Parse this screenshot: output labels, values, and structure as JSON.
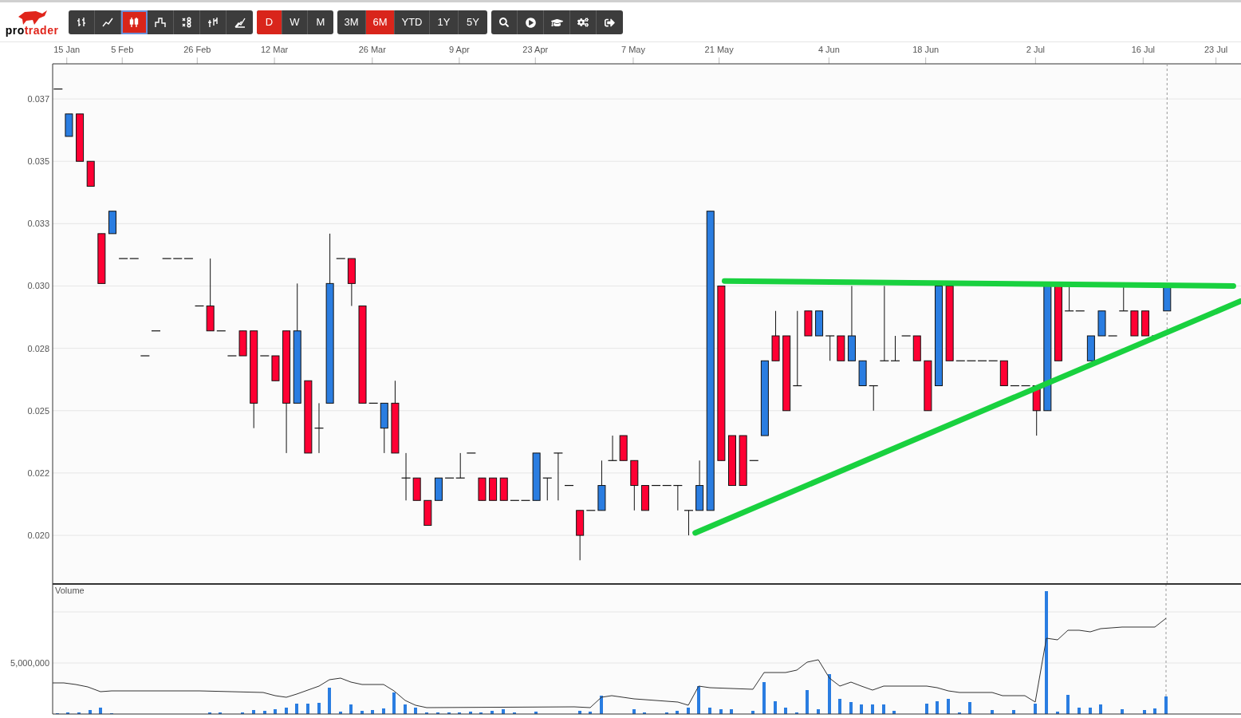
{
  "logo": {
    "prefix": "pro",
    "suffix": "trader"
  },
  "toolbar": {
    "chart_types": [
      {
        "kind": "ohlc",
        "selected": false
      },
      {
        "kind": "line",
        "selected": false
      },
      {
        "kind": "candlestick",
        "selected": true
      },
      {
        "kind": "step",
        "selected": false
      },
      {
        "kind": "point-figure",
        "selected": false
      },
      {
        "kind": "hlc",
        "selected": false
      },
      {
        "kind": "mountain",
        "selected": false
      }
    ],
    "intervals": [
      {
        "label": "D",
        "selected": true
      },
      {
        "label": "W",
        "selected": false
      },
      {
        "label": "M",
        "selected": false
      }
    ],
    "ranges": [
      {
        "label": "3M",
        "selected": false
      },
      {
        "label": "6M",
        "selected": true
      },
      {
        "label": "YTD",
        "selected": false
      },
      {
        "label": "1Y",
        "selected": false
      },
      {
        "label": "5Y",
        "selected": false
      }
    ],
    "tools": [
      {
        "kind": "search"
      },
      {
        "kind": "play"
      },
      {
        "kind": "tutorial"
      },
      {
        "kind": "settings"
      },
      {
        "kind": "exit"
      }
    ]
  },
  "price_chart": {
    "date_labels": [
      "15 Jan",
      "5 Feb",
      "26 Feb",
      "12 Mar",
      "26 Mar",
      "9 Apr",
      "23 Apr",
      "7 May",
      "21 May",
      "4 Jun",
      "18 Jun",
      "2 Jul",
      "16 Jul",
      "23 Jul"
    ],
    "price_labels": [
      "0.037",
      "0.035",
      "0.033",
      "0.030",
      "0.028",
      "0.025",
      "0.022",
      "0.020"
    ]
  },
  "volume_panel": {
    "title": "Volume",
    "axis_label": "5,000,000"
  }
}
